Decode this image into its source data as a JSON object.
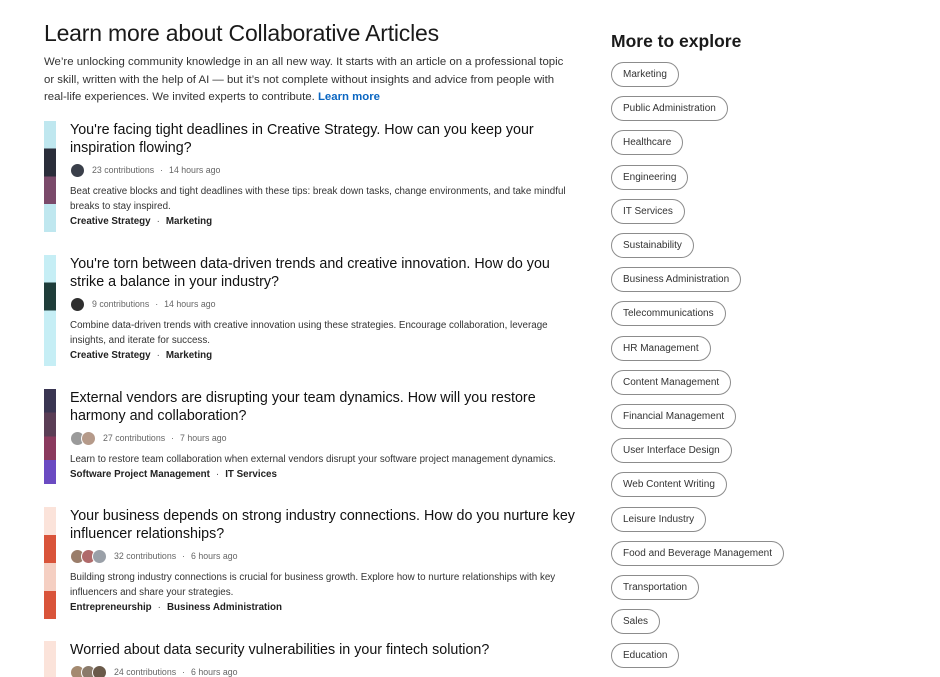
{
  "page": {
    "title": "Learn more about Collaborative Articles",
    "intro": "We’re unlocking community knowledge in an all new way. It starts with an article on a professional topic or skill, written with the help of AI — but it’s not complete without insights and advice from people with real-life experiences. We invited experts to contribute.",
    "learn_more": "Learn more"
  },
  "articles": [
    {
      "title": "You're facing tight deadlines in Creative Strategy. How can you keep your inspiration flowing?",
      "contributions": "23 contributions",
      "time": "14 hours ago",
      "summary": "Beat creative blocks and tight deadlines with these tips: break down tasks, change environments, and take mindful breaks to stay inspired.",
      "tags": [
        "Creative Strategy",
        "Marketing"
      ],
      "avatars": [
        "#3a3f4a"
      ],
      "thumb_colors": [
        "#bfe7ef",
        "#2a2d3a",
        "#7a4a6a",
        "#bfe7ef"
      ]
    },
    {
      "title": "You're torn between data-driven trends and creative innovation. How do you strike a balance in your industry?",
      "contributions": "9 contributions",
      "time": "14 hours ago",
      "summary": "Combine data-driven trends with creative innovation using these strategies. Encourage collaboration, leverage insights, and iterate for success.",
      "tags": [
        "Creative Strategy",
        "Marketing"
      ],
      "avatars": [
        "#2f2f2f"
      ],
      "thumb_colors": [
        "#c6eef5",
        "#1f3d3a",
        "#c6eef5",
        "#c6eef5"
      ]
    },
    {
      "title": "External vendors are disrupting your team dynamics. How will you restore harmony and collaboration?",
      "contributions": "27 contributions",
      "time": "7 hours ago",
      "summary": "Learn to restore team collaboration when external vendors disrupt your software project management dynamics.",
      "tags": [
        "Software Project Management",
        "IT Services"
      ],
      "avatars": [
        "#9a9a9a",
        "#b59a8a"
      ],
      "thumb_colors": [
        "#3a3552",
        "#5a3d55",
        "#8a3a5e",
        "#6b4bc2"
      ]
    },
    {
      "title": "Your business depends on strong industry connections. How do you nurture key influencer relationships?",
      "contributions": "32 contributions",
      "time": "6 hours ago",
      "summary": "Building strong industry connections is crucial for business growth. Explore how to nurture relationships with key influencers and share your strategies.",
      "tags": [
        "Entrepreneurship",
        "Business Administration"
      ],
      "avatars": [
        "#9a7d6a",
        "#b06a6a",
        "#9aa0a8"
      ],
      "thumb_colors": [
        "#fbe3da",
        "#d9543a",
        "#f5cfc2",
        "#d9543a"
      ]
    },
    {
      "title": "Worried about data security vulnerabilities in your fintech solution?",
      "contributions": "24 contributions",
      "time": "6 hours ago",
      "summary": "",
      "tags": [],
      "avatars": [
        "#a48a70",
        "#8a7a6a",
        "#6a5a4a"
      ],
      "thumb_colors": [
        "#fbe3da",
        "#fbe3da",
        "#fbe3da",
        "#fbe3da"
      ]
    }
  ],
  "sidebar": {
    "title": "More to explore",
    "topics": [
      "Marketing",
      "Public Administration",
      "Healthcare",
      "Engineering",
      "IT Services",
      "Sustainability",
      "Business Administration",
      "Telecommunications",
      "HR Management",
      "Content Management",
      "Financial Management",
      "User Interface Design",
      "Web Content Writing",
      "Leisure Industry",
      "Food and Beverage Management",
      "Transportation",
      "Sales",
      "Education"
    ]
  }
}
